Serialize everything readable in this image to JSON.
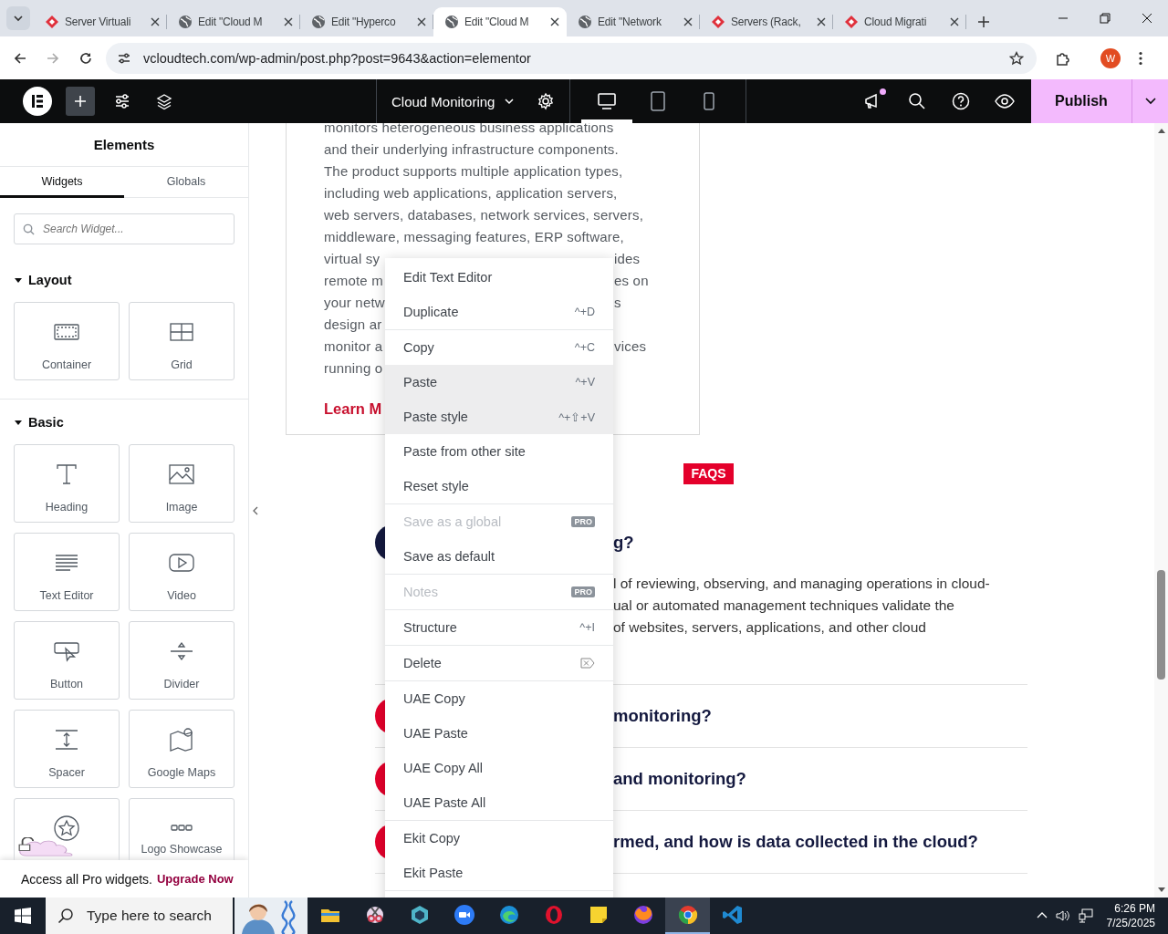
{
  "browser": {
    "tabs": [
      {
        "title": "Server Virtuali",
        "selected": false
      },
      {
        "title": "Edit \"Cloud M",
        "selected": false
      },
      {
        "title": "Edit \"Hyperco",
        "selected": false
      },
      {
        "title": "Edit \"Cloud M",
        "selected": true
      },
      {
        "title": "Edit \"Network",
        "selected": false
      },
      {
        "title": "Servers (Rack,",
        "selected": false
      },
      {
        "title": "Cloud Migrati",
        "selected": false
      }
    ],
    "url": "vcloudtech.com/wp-admin/post.php?post=9643&action=elementor",
    "profile": "W"
  },
  "editor_bar": {
    "page_title": "Cloud Monitoring",
    "devices": [
      {
        "selected": true
      },
      {
        "selected": false
      },
      {
        "selected": false
      }
    ],
    "notification": true,
    "publish": "Publish"
  },
  "panel": {
    "title": "Elements",
    "tabs": [
      {
        "label": "Widgets",
        "selected": true
      },
      {
        "label": "Globals",
        "selected": false
      }
    ],
    "search": {
      "placeholder": "Search Widget..."
    },
    "sections": [
      {
        "title": "Layout",
        "expanded": true,
        "widgets": [
          {
            "kind": "widget",
            "label": "Container"
          },
          {
            "kind": "widget",
            "label": "Grid"
          }
        ]
      },
      {
        "title": "Basic",
        "expanded": true,
        "widgets": [
          {
            "kind": "widget",
            "label": "Heading"
          },
          {
            "kind": "widget",
            "label": "Image"
          },
          {
            "kind": "widget",
            "label": "Text Editor"
          },
          {
            "kind": "widget",
            "label": "Video"
          },
          {
            "kind": "widget",
            "label": "Button"
          },
          {
            "kind": "widget",
            "label": "Divider"
          },
          {
            "kind": "widget",
            "label": "Spacer"
          },
          {
            "kind": "widget",
            "label": "Google Maps"
          },
          {
            "kind": "promo"
          },
          {
            "kind": "widget",
            "label": "Logo Showcase"
          }
        ]
      }
    ],
    "promo": {
      "text": "Access all Pro widgets.",
      "link": "Upgrade Now"
    }
  },
  "canvas": {
    "card": {
      "lines": [
        {
          "left": "monitors heterogeneous business applications"
        },
        {
          "left": "and their underlying infrastructure components."
        },
        {
          "left": "The product supports multiple application types,"
        },
        {
          "left": "including web applications, application servers,"
        },
        {
          "left": "web servers, databases, network services, servers,"
        },
        {
          "left": "middleware, messaging features, ERP software,"
        },
        {
          "left": "virtual sy",
          "right": "ides"
        },
        {
          "left": "remote m",
          "right": "es on"
        },
        {
          "left": "your netw",
          "right": "s"
        },
        {
          "left": "design ar"
        },
        {
          "left": "monitor a",
          "right": "vices"
        },
        {
          "left": "running o"
        }
      ],
      "link": "Learn M"
    },
    "faq": {
      "badge": "FAQS",
      "items": [
        {
          "expanded": true,
          "question": "g?",
          "answer_lines": [
            "l of reviewing, observing, and managing operations in cloud-",
            "ual or automated management techniques validate the",
            "of websites, servers, applications, and other cloud"
          ]
        },
        {
          "expanded": false,
          "question": "monitoring?"
        },
        {
          "expanded": false,
          "question": "and monitoring?"
        },
        {
          "expanded": false,
          "question": "rmed, and how is data collected in the cloud?"
        }
      ]
    }
  },
  "context_menu": {
    "groups": [
      [
        {
          "label": "Edit Text Editor",
          "disabled": false,
          "highlighted": false
        },
        {
          "label": "Duplicate",
          "shortcut": "^+D",
          "disabled": false,
          "highlighted": false
        }
      ],
      [
        {
          "label": "Copy",
          "shortcut": "^+C",
          "disabled": false,
          "highlighted": false
        },
        {
          "label": "Paste",
          "shortcut": "^+V",
          "disabled": false,
          "highlighted": true
        },
        {
          "label": "Paste style",
          "shortcut": "^+⇧+V",
          "disabled": false,
          "highlighted": true
        },
        {
          "label": "Paste from other site",
          "disabled": false,
          "highlighted": false
        },
        {
          "label": "Reset style",
          "disabled": false,
          "highlighted": false
        }
      ],
      [
        {
          "label": "Save as a global",
          "badge": "PRO",
          "disabled": true,
          "highlighted": false
        },
        {
          "label": "Save as default",
          "disabled": false,
          "highlighted": false
        }
      ],
      [
        {
          "label": "Notes",
          "badge": "PRO",
          "disabled": true,
          "highlighted": false
        }
      ],
      [
        {
          "label": "Structure",
          "shortcut": "^+I",
          "disabled": false,
          "highlighted": false
        }
      ],
      [
        {
          "label": "Delete",
          "key_icon": true,
          "disabled": false,
          "highlighted": false
        }
      ],
      [
        {
          "label": "UAE Copy",
          "disabled": false,
          "highlighted": false
        },
        {
          "label": "UAE Paste",
          "disabled": false,
          "highlighted": false
        },
        {
          "label": "UAE Copy All",
          "disabled": false,
          "highlighted": false
        },
        {
          "label": "UAE Paste All",
          "disabled": false,
          "highlighted": false
        }
      ],
      [
        {
          "label": "Ekit Copy",
          "disabled": false,
          "highlighted": false
        },
        {
          "label": "Ekit Paste",
          "disabled": false,
          "highlighted": false
        }
      ]
    ]
  },
  "taskbar": {
    "search_placeholder": "Type here to search",
    "apps": [
      {
        "selected": false
      },
      {
        "selected": false
      },
      {
        "selected": false
      },
      {
        "selected": false
      },
      {
        "selected": false
      },
      {
        "selected": false
      },
      {
        "selected": false
      },
      {
        "selected": false
      },
      {
        "selected": true
      },
      {
        "selected": false
      }
    ],
    "time": "6:26 PM",
    "date": "7/25/2025"
  }
}
